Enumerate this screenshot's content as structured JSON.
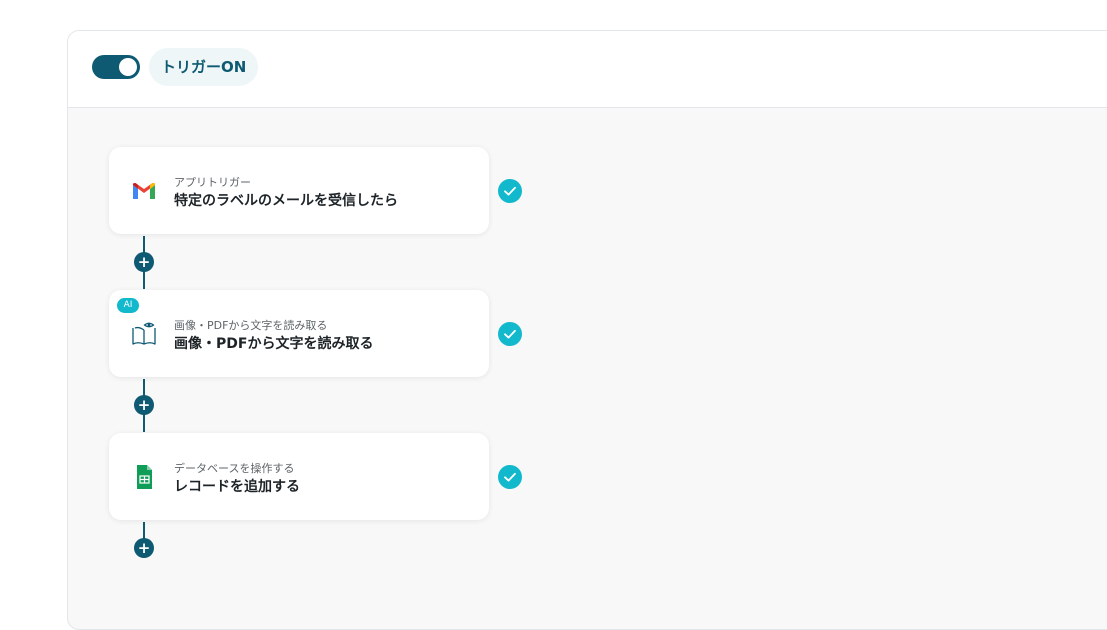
{
  "header": {
    "toggle_state": "on",
    "trigger_label": "トリガーON"
  },
  "steps": [
    {
      "subtitle": "アプリトリガー",
      "title": "特定のラベルのメールを受信したら",
      "icon": "gmail-icon",
      "status": "completed"
    },
    {
      "badge": "AI",
      "subtitle": "画像・PDFから文字を読み取る",
      "title": "画像・PDFから文字を読み取る",
      "icon": "ocr-book-icon",
      "status": "completed"
    },
    {
      "subtitle": "データベースを操作する",
      "title": "レコードを追加する",
      "icon": "google-sheets-icon",
      "status": "completed"
    }
  ],
  "add_step_symbol": "+",
  "colors": {
    "accent": "#0d5a72",
    "check": "#12b9cc",
    "badge_bg": "#eef6f7",
    "canvas_bg": "#f8f8f8"
  }
}
